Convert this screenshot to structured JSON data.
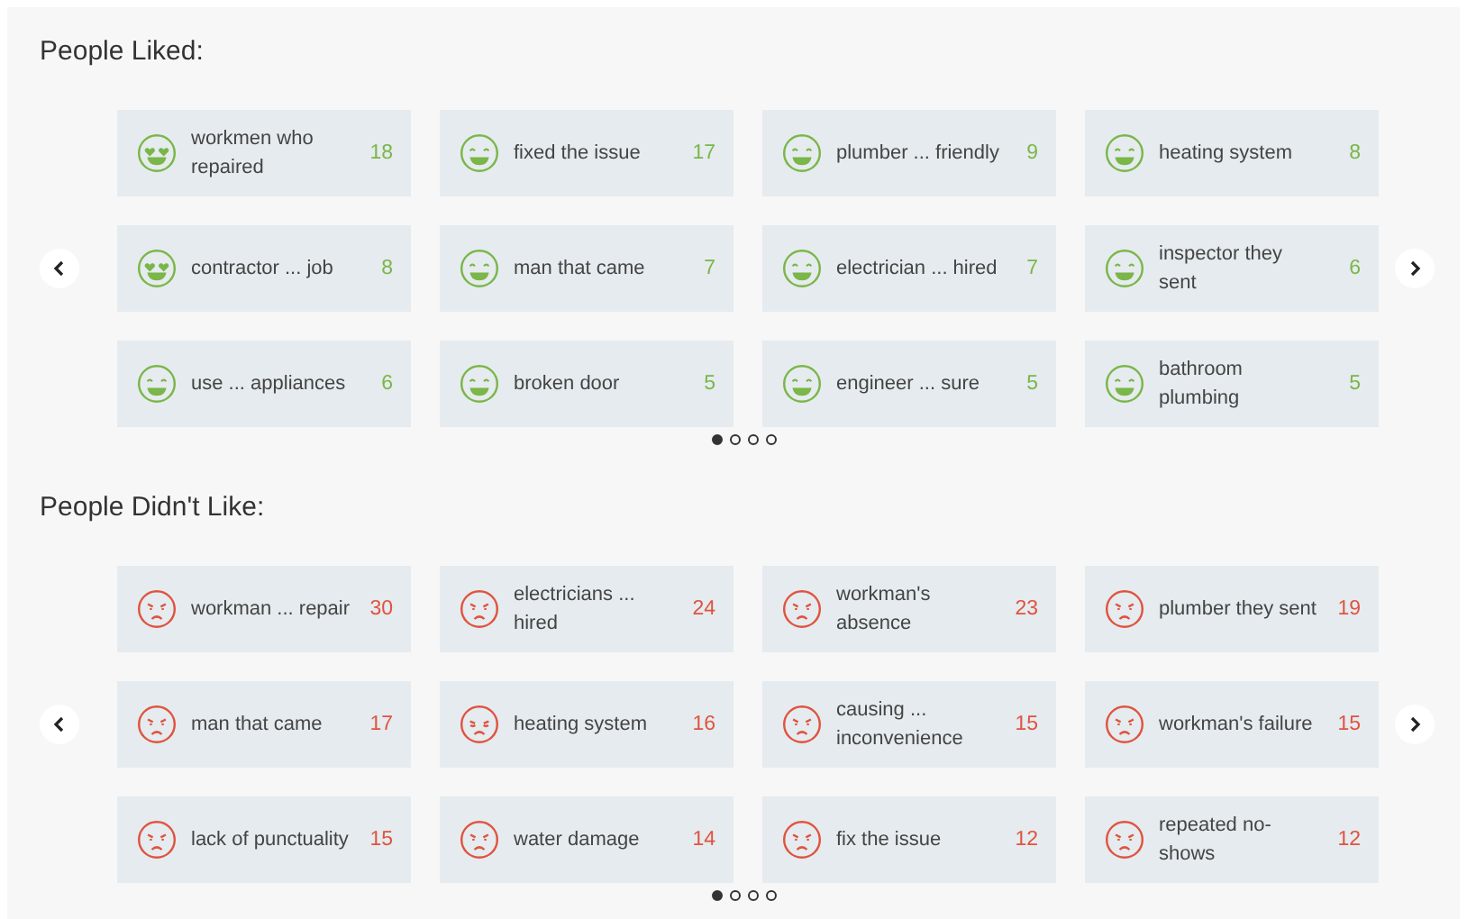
{
  "sections": [
    {
      "title": "People Liked:",
      "color": "#7ab648",
      "pager": [
        {
          "selected": true
        },
        {
          "selected": false
        },
        {
          "selected": false
        },
        {
          "selected": false
        }
      ],
      "items": [
        {
          "kind": "love",
          "label": "workmen who repaired",
          "count": "18"
        },
        {
          "kind": "grin",
          "label": "fixed the issue",
          "count": "17"
        },
        {
          "kind": "grin",
          "label": "plumber ... friendly",
          "count": "9"
        },
        {
          "kind": "grin",
          "label": "heating system",
          "count": "8"
        },
        {
          "kind": "love",
          "label": "contractor ... job",
          "count": "8"
        },
        {
          "kind": "grin",
          "label": "man that came",
          "count": "7"
        },
        {
          "kind": "grin",
          "label": "electrician ... hired",
          "count": "7"
        },
        {
          "kind": "grin",
          "label": "inspector they sent",
          "count": "6"
        },
        {
          "kind": "grin",
          "label": "use ... appliances",
          "count": "6"
        },
        {
          "kind": "grin",
          "label": "broken door",
          "count": "5"
        },
        {
          "kind": "grin",
          "label": "engineer ... sure",
          "count": "5"
        },
        {
          "kind": "grin",
          "label": "bathroom plumbing",
          "count": "5"
        }
      ]
    },
    {
      "title": "People Didn't Like:",
      "color": "#e0533f",
      "pager": [
        {
          "selected": true
        },
        {
          "selected": false
        },
        {
          "selected": false
        },
        {
          "selected": false
        }
      ],
      "items": [
        {
          "kind": "angry",
          "label": "workman ... repair",
          "count": "30"
        },
        {
          "kind": "angry",
          "label": "electricians ... hired",
          "count": "24"
        },
        {
          "kind": "angry",
          "label": "workman's absence",
          "count": "23"
        },
        {
          "kind": "angry",
          "label": "plumber they sent",
          "count": "19"
        },
        {
          "kind": "angry",
          "label": "man that came",
          "count": "17"
        },
        {
          "kind": "sad",
          "label": "heating system",
          "count": "16"
        },
        {
          "kind": "angry",
          "label": "causing ... inconvenience",
          "count": "15"
        },
        {
          "kind": "angry",
          "label": "workman's failure",
          "count": "15"
        },
        {
          "kind": "angry",
          "label": "lack of punctuality",
          "count": "15"
        },
        {
          "kind": "angry",
          "label": "water damage",
          "count": "14"
        },
        {
          "kind": "angry",
          "label": "fix the issue",
          "count": "12"
        },
        {
          "kind": "angry",
          "label": "repeated no-shows",
          "count": "12"
        }
      ]
    }
  ]
}
